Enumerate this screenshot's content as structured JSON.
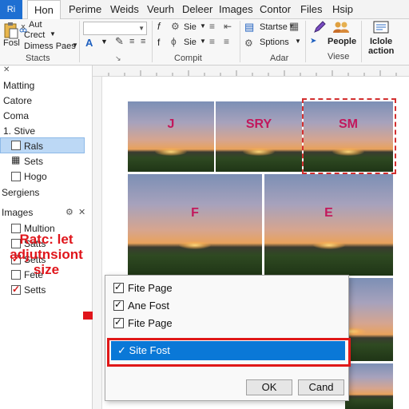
{
  "tabs": {
    "logo": "Ri",
    "items": [
      "Hon",
      "Perime",
      "Weids",
      "Veurh",
      "Deleer",
      "Images",
      "Contor",
      "Files",
      "Hsip"
    ]
  },
  "ribbon": {
    "paste_label": "Fosl",
    "aut_label": "Aut",
    "crect_label": "Crect",
    "dimess_label": "Dimess Paes",
    "stacts_group": "Stacts",
    "compt_group": "Compit",
    "adar_group": "Adar",
    "viese_group": "Viese",
    "sie_1": "Sie",
    "sie_2": "Sie",
    "f_label": "f",
    "a_label": "A",
    "startse": "Startse",
    "sptions": "Sptions",
    "people": "People",
    "iclole": "Iclole",
    "action": "action"
  },
  "left_panel": {
    "items": [
      "Matting",
      "Catore",
      "Coma",
      "1. Stive",
      "Rals",
      "Sets",
      "Hogo",
      "Sergiens",
      "Images",
      "Multion",
      "Satts",
      "Setts",
      "Fete",
      "Setts"
    ],
    "annotation": "Ratc: let adjutnsiont size"
  },
  "photos": [
    "J",
    "SRY",
    "SM",
    "F",
    "E"
  ],
  "dialog": {
    "options": [
      "Fite Page",
      "Ane Fost",
      "Fite Page"
    ],
    "selected_option": "Site Fost",
    "ok": "OK",
    "cancel": "Cand"
  },
  "colors": {
    "accent": "#0a78d7",
    "highlight_red": "#e01818",
    "selection_blue": "#bcd8f5"
  }
}
